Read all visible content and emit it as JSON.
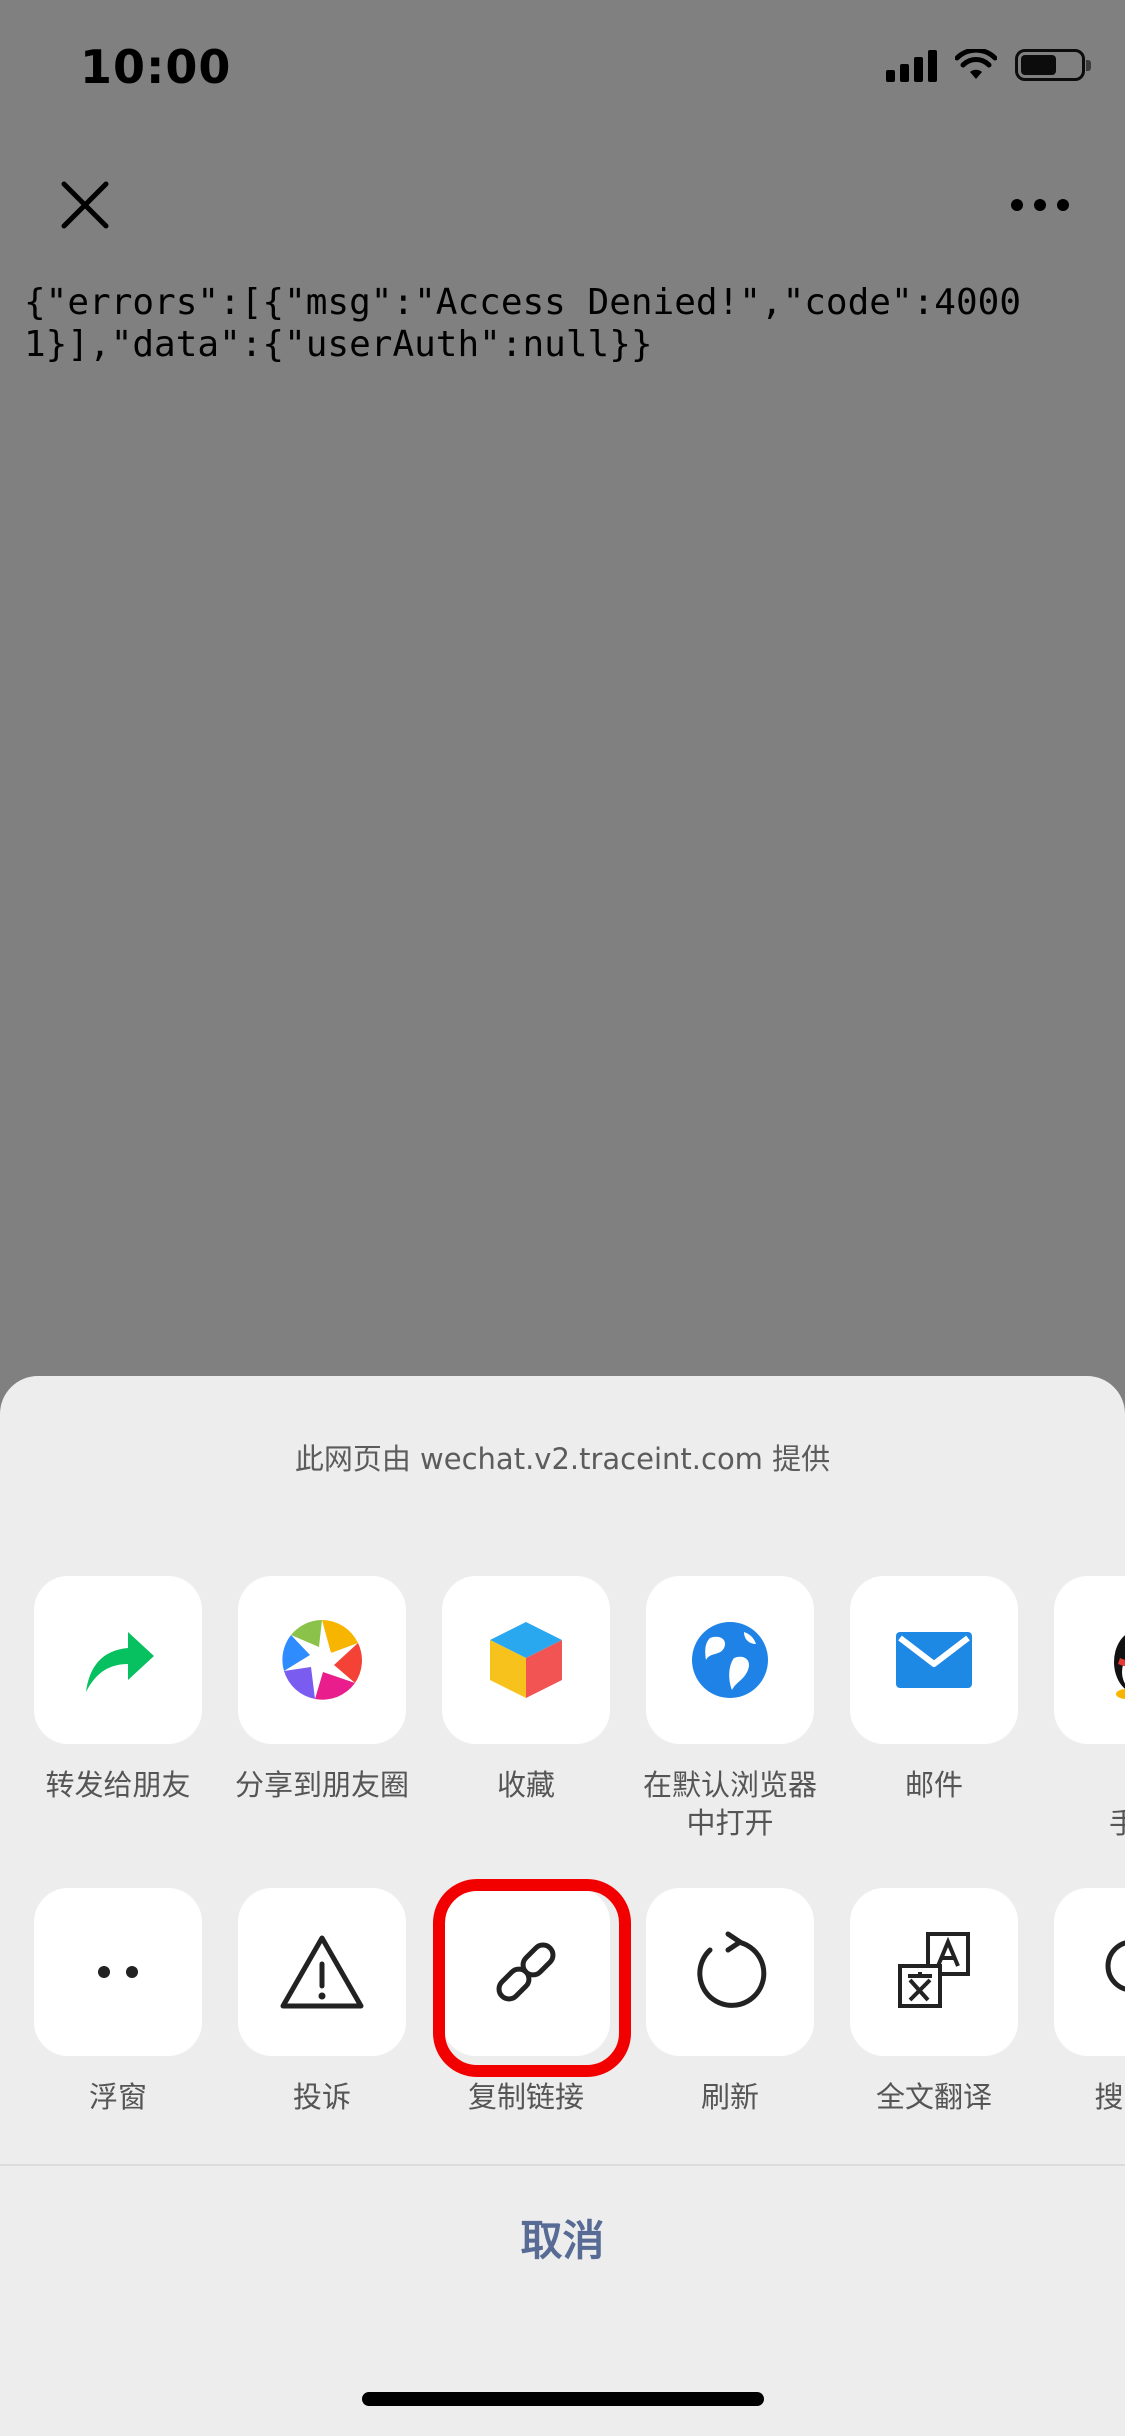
{
  "status_bar": {
    "time": "10:00"
  },
  "nav": {
    "close_icon": "close-icon",
    "more_icon": "more-horizontal-icon"
  },
  "page": {
    "json_text": "{\"errors\":[{\"msg\":\"Access Denied!\",\"code\":40001}],\"data\":{\"userAuth\":null}}"
  },
  "share_sheet": {
    "provider_text": "此网页由 wechat.v2.traceint.com 提供",
    "row1": [
      {
        "label": "转发给朋友",
        "icon": "forward-icon"
      },
      {
        "label": "分享到朋友圈",
        "icon": "moments-icon"
      },
      {
        "label": "收藏",
        "icon": "favorite-cube-icon"
      },
      {
        "label": "在默认浏览器\n中打开",
        "icon": "browser-globe-icon"
      },
      {
        "label": "邮件",
        "icon": "mail-icon"
      },
      {
        "label": "分\n手机",
        "icon": "qq-icon"
      }
    ],
    "row2": [
      {
        "label": "浮窗",
        "icon": "float-window-icon"
      },
      {
        "label": "投诉",
        "icon": "warning-icon"
      },
      {
        "label": "复制链接",
        "icon": "link-icon",
        "highlighted": true
      },
      {
        "label": "刷新",
        "icon": "refresh-icon"
      },
      {
        "label": "全文翻译",
        "icon": "translate-icon"
      },
      {
        "label": "搜索页",
        "icon": "search-icon"
      }
    ],
    "cancel_label": "取消"
  },
  "colors": {
    "overlay": "#808080",
    "sheet_bg": "#ededed",
    "cancel_text": "#576b95",
    "highlight": "#f20000",
    "wechat_green": "#07c160",
    "browser_blue": "#1e82e6"
  }
}
